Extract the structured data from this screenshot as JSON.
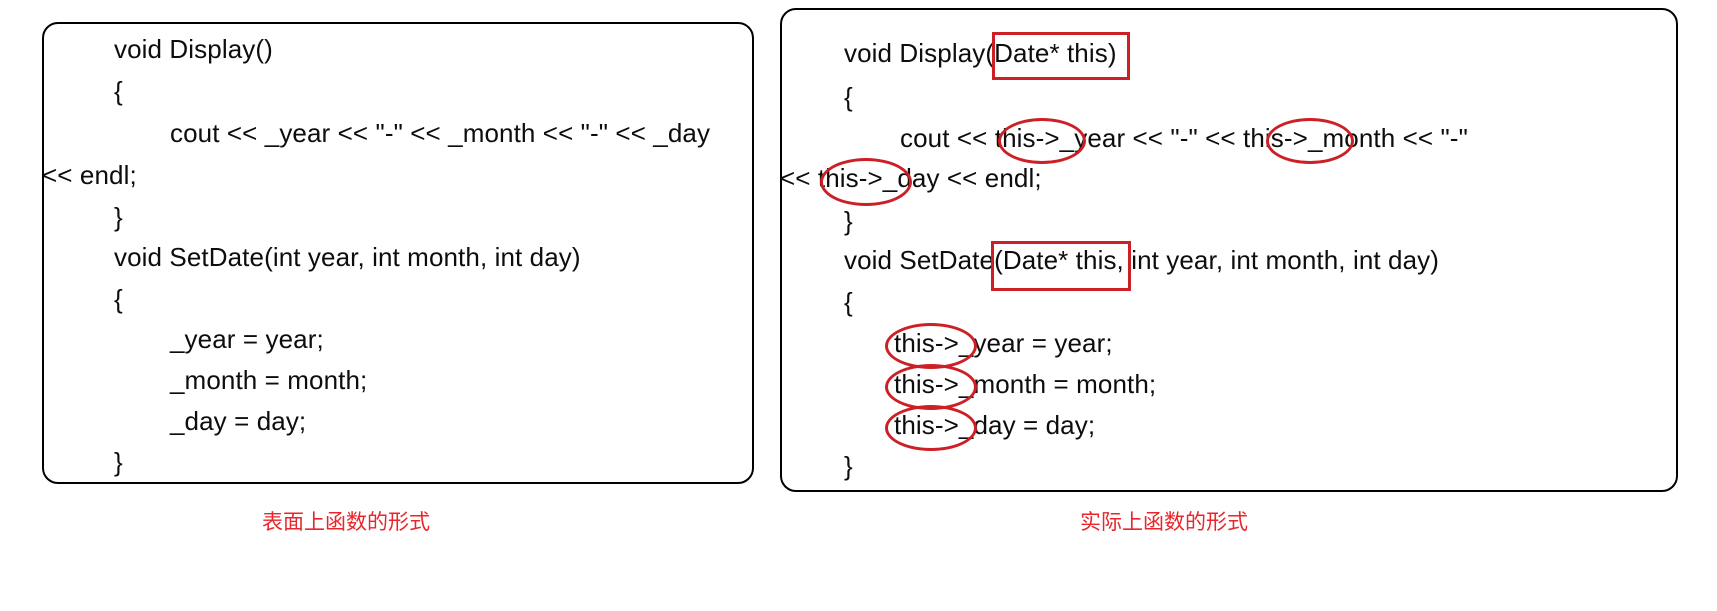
{
  "figure": {
    "title_left": "表面上函数的形式",
    "title_right": "实际上函数的形式",
    "accent_color": "#cc2026",
    "caption_color": "#e8262b",
    "text_color": "#0d0d0d",
    "border_color": "#000000"
  },
  "panels": {
    "left": {
      "caption": "表面上函数的形式",
      "code_lines": [
        "void Display()",
        "{",
        "cout << _year << \"-\" << _month << \"-\" << _day",
        "<< endl;",
        "}",
        "void SetDate(int year, int month, int day)",
        "{",
        "_year = year;",
        "_month = month;",
        "_day = day;",
        "}"
      ]
    },
    "right": {
      "caption": "实际上函数的形式",
      "code_lines": [
        "void Display(Date* this)",
        "{",
        "cout << this->_year << \"-\" << this->_month << \"-\"",
        "<< this->_day << endl;",
        "}",
        "void SetDate(Date* this, int year, int month, int day)",
        "{",
        "this->_year = year;",
        "this->_month = month;",
        "this->_day = day;",
        "}"
      ],
      "annotations": [
        {
          "shape": "box",
          "target": "(Date* this)"
        },
        {
          "shape": "ellipse",
          "target": "this->"
        },
        {
          "shape": "ellipse",
          "target": "this->"
        },
        {
          "shape": "ellipse",
          "target": "this->"
        },
        {
          "shape": "box",
          "target": "(Date* this,"
        },
        {
          "shape": "ellipse",
          "target": "this->"
        },
        {
          "shape": "ellipse",
          "target": "this->"
        },
        {
          "shape": "ellipse",
          "target": "this->"
        }
      ]
    }
  }
}
